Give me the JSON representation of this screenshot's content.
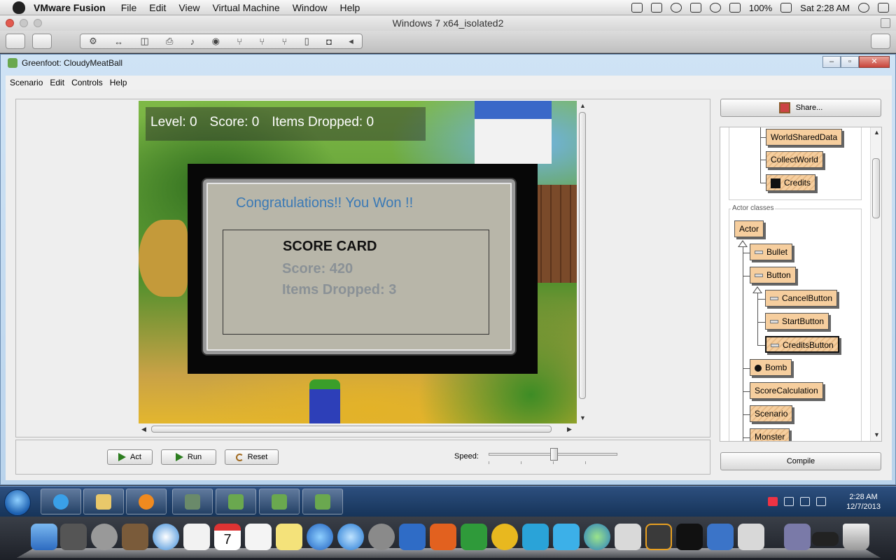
{
  "mac_menubar": {
    "app_name": "VMware Fusion",
    "menus": [
      "File",
      "Edit",
      "View",
      "Virtual Machine",
      "Window",
      "Help"
    ],
    "battery": "100%",
    "clock": "Sat 2:28 AM"
  },
  "vmware": {
    "window_title": "Windows 7 x64_isolated2"
  },
  "greenfoot": {
    "window_title": "Greenfoot: CloudyMeatBall",
    "menu": [
      "Scenario",
      "Edit",
      "Controls",
      "Help"
    ],
    "hud": {
      "level": "Level: 0",
      "score": "Score: 0",
      "items_dropped": "Items Dropped: 0"
    },
    "popup": {
      "heading": "Congratulations!! You Won !!",
      "card_title": "SCORE CARD",
      "score_line": "Score: 420",
      "items_line": "Items Dropped: 3"
    },
    "controls": {
      "act_label": "Act",
      "run_label": "Run",
      "reset_label": "Reset",
      "speed_label": "Speed:",
      "speed_value": 0.5
    },
    "share_label": "Share...",
    "compile_label": "Compile",
    "actor_classes_label": "Actor classes",
    "world_classes": [
      "WorldSharedData",
      "CollectWorld",
      "Credits"
    ],
    "actor_classes": [
      "Actor",
      "Bullet",
      "Button",
      "CancelButton",
      "StartButton",
      "CreditsButton",
      "Bomb",
      "ScoreCalculation",
      "Scenario",
      "Monster"
    ]
  },
  "taskbar": {
    "time": "2:28 AM",
    "date": "12/7/2013"
  },
  "dock": {
    "calendar_day": "7"
  },
  "colors": {
    "class_fill": "#f6ce9e",
    "congrats_text": "#3a79b5",
    "taskbar": "#1e3f6b"
  }
}
